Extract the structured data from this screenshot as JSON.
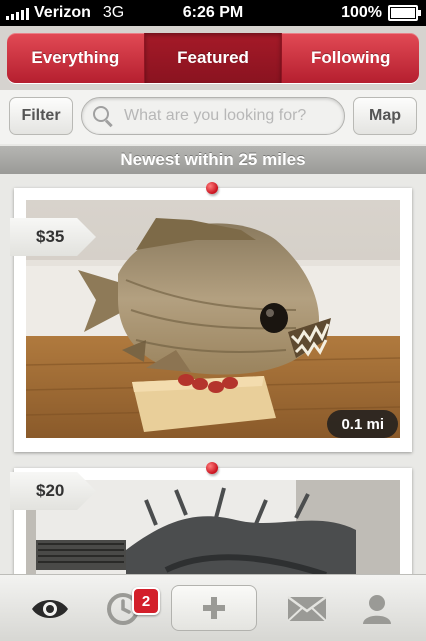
{
  "status_bar": {
    "carrier": "Verizon",
    "network": "3G",
    "time": "6:26 PM",
    "battery": "100%"
  },
  "tabs": [
    {
      "label": "Everything",
      "active": false
    },
    {
      "label": "Featured",
      "active": true
    },
    {
      "label": "Following",
      "active": false
    }
  ],
  "toolbar": {
    "filter_label": "Filter",
    "search_placeholder": "What are you looking for?",
    "map_label": "Map"
  },
  "section_header": "Newest within 25 miles",
  "listings": [
    {
      "price": "$35",
      "distance": "0.1 mi"
    },
    {
      "price": "$20"
    }
  ],
  "tabbar": {
    "activity_badge": "2",
    "items": [
      "eye-icon",
      "clock-icon",
      "plus-icon",
      "envelope-icon",
      "person-icon"
    ]
  },
  "colors": {
    "accent_red": "#c8202f",
    "active_tab_red": "#8a1320",
    "pin_red": "#c8101c"
  }
}
